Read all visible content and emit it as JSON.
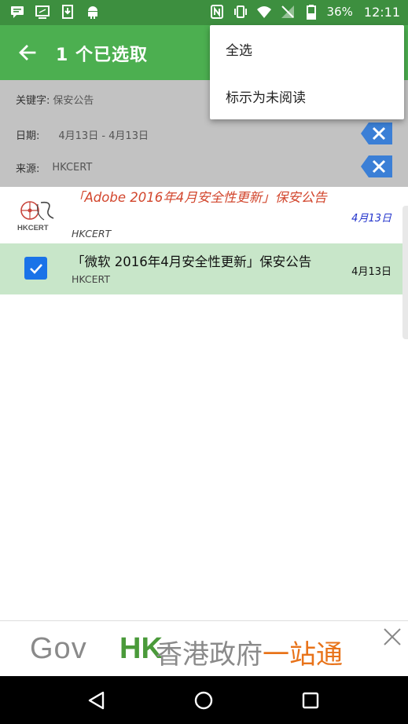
{
  "status_bar": {
    "battery": "36%",
    "time": "12:11",
    "icons": [
      "chat-icon",
      "cast-icon",
      "download-icon",
      "android-icon",
      "nfc-icon",
      "vibrate-icon",
      "wifi-icon",
      "no-signal-icon",
      "battery-icon"
    ]
  },
  "app_bar": {
    "title": "1 个已选取",
    "color": "#4caf50"
  },
  "filters": {
    "keyword_label": "关键字:",
    "keyword_value": "保安公告",
    "date_label": "日期:",
    "date_value": "4月13日 - 4月13日",
    "source_label": "来源:",
    "source_value": "HKCERT"
  },
  "overflow_menu": {
    "items": [
      {
        "label": "全选"
      },
      {
        "label": "标示为未阅读"
      }
    ]
  },
  "list": {
    "items": [
      {
        "title": "「Adobe 2016年4月安全性更新」保安公告",
        "source": "HKCERT",
        "date": "4月13日",
        "logo_text": "HKCERT",
        "selected": false,
        "unread": true
      },
      {
        "title": "「微软 2016年4月安全性更新」保安公告",
        "source": "HKCERT",
        "date": "4月13日",
        "selected": true,
        "unread": false
      }
    ]
  },
  "ad_banner": {
    "gov": "Gov",
    "hk": "HK",
    "zh1": "香港政府",
    "zh2": "一站通"
  },
  "colors": {
    "status_bar": "#3d8f3f",
    "app_bar": "#4caf50",
    "selected_row": "#c8e6c9",
    "checkbox": "#1a73e8",
    "clear_tag": "#3b7fd6",
    "unread_title": "#d2462d",
    "unread_date": "#2233cc"
  }
}
